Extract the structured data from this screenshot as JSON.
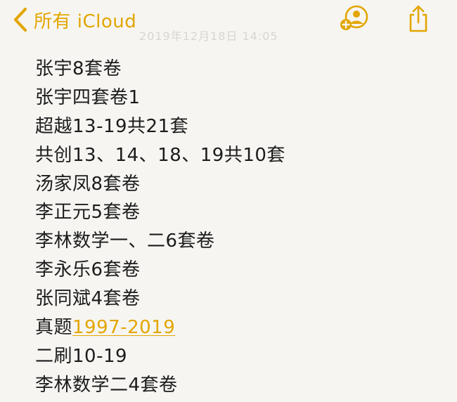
{
  "nav": {
    "back_label": "所有 iCloud",
    "faded_date": "2019年12月18日 14:05"
  },
  "colors": {
    "accent": "#e3a600",
    "background": "#f6f5f2",
    "text": "#1c1c1c"
  },
  "icons": {
    "back": "chevron-left-icon",
    "collaborate": "add-person-icon",
    "share": "share-icon"
  },
  "note": {
    "lines": [
      "张宇8套卷",
      "张宇四套卷1",
      "超越13-19共21套",
      "共创13、14、18、19共10套",
      "汤家凤8套卷",
      "李正元5套卷",
      "李林数学一、二6套卷",
      "李永乐6套卷",
      "张同斌4套卷",
      "真题",
      "二刷10-19",
      "李林数学二4套卷"
    ],
    "link_text": "1997-2019"
  }
}
